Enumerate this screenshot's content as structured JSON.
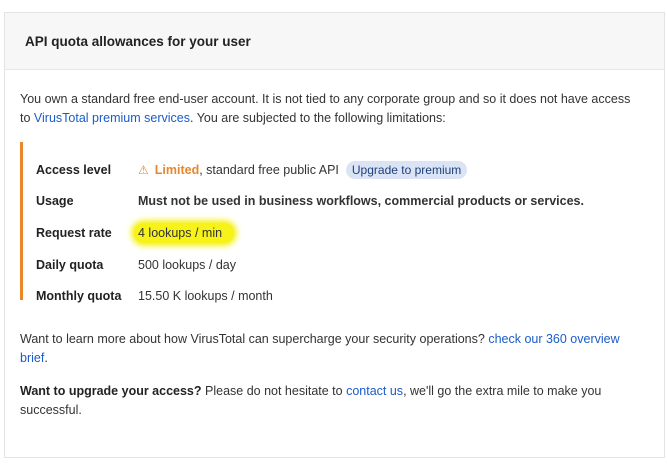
{
  "header": {
    "title": "API quota allowances for your user"
  },
  "intro": {
    "text_before": "You own a standard free end-user account. It is not tied to any corporate group and so it does not have access to ",
    "link": "VirusTotal premium services",
    "text_after": ". You are subjected to the following limitations:"
  },
  "limits": {
    "access_level": {
      "label": "Access level",
      "icon": "warning-icon",
      "status": "Limited",
      "rest": ", standard free public API",
      "upgrade": "Upgrade to premium"
    },
    "usage": {
      "label": "Usage",
      "value": "Must not be used in business workflows, commercial products or services."
    },
    "request_rate": {
      "label": "Request rate",
      "value": "4 lookups / min"
    },
    "daily_quota": {
      "label": "Daily quota",
      "value": "500 lookups / day"
    },
    "monthly_quota": {
      "label": "Monthly quota",
      "value": "15.50 K lookups / month"
    }
  },
  "learn_more": {
    "text": "Want to learn more about how VirusTotal can supercharge your security operations? ",
    "link": "check our 360 overview brief",
    "end": "."
  },
  "upgrade_access": {
    "bold": "Want to upgrade your access?",
    "text": " Please do not hesitate to ",
    "link": "contact us",
    "end": ", we'll go the extra mile to make you successful."
  },
  "colors": {
    "accent": "#e8872b",
    "link": "#1a5cc8",
    "highlight": "#f6f21a",
    "pill_bg": "#dbe4f5"
  }
}
